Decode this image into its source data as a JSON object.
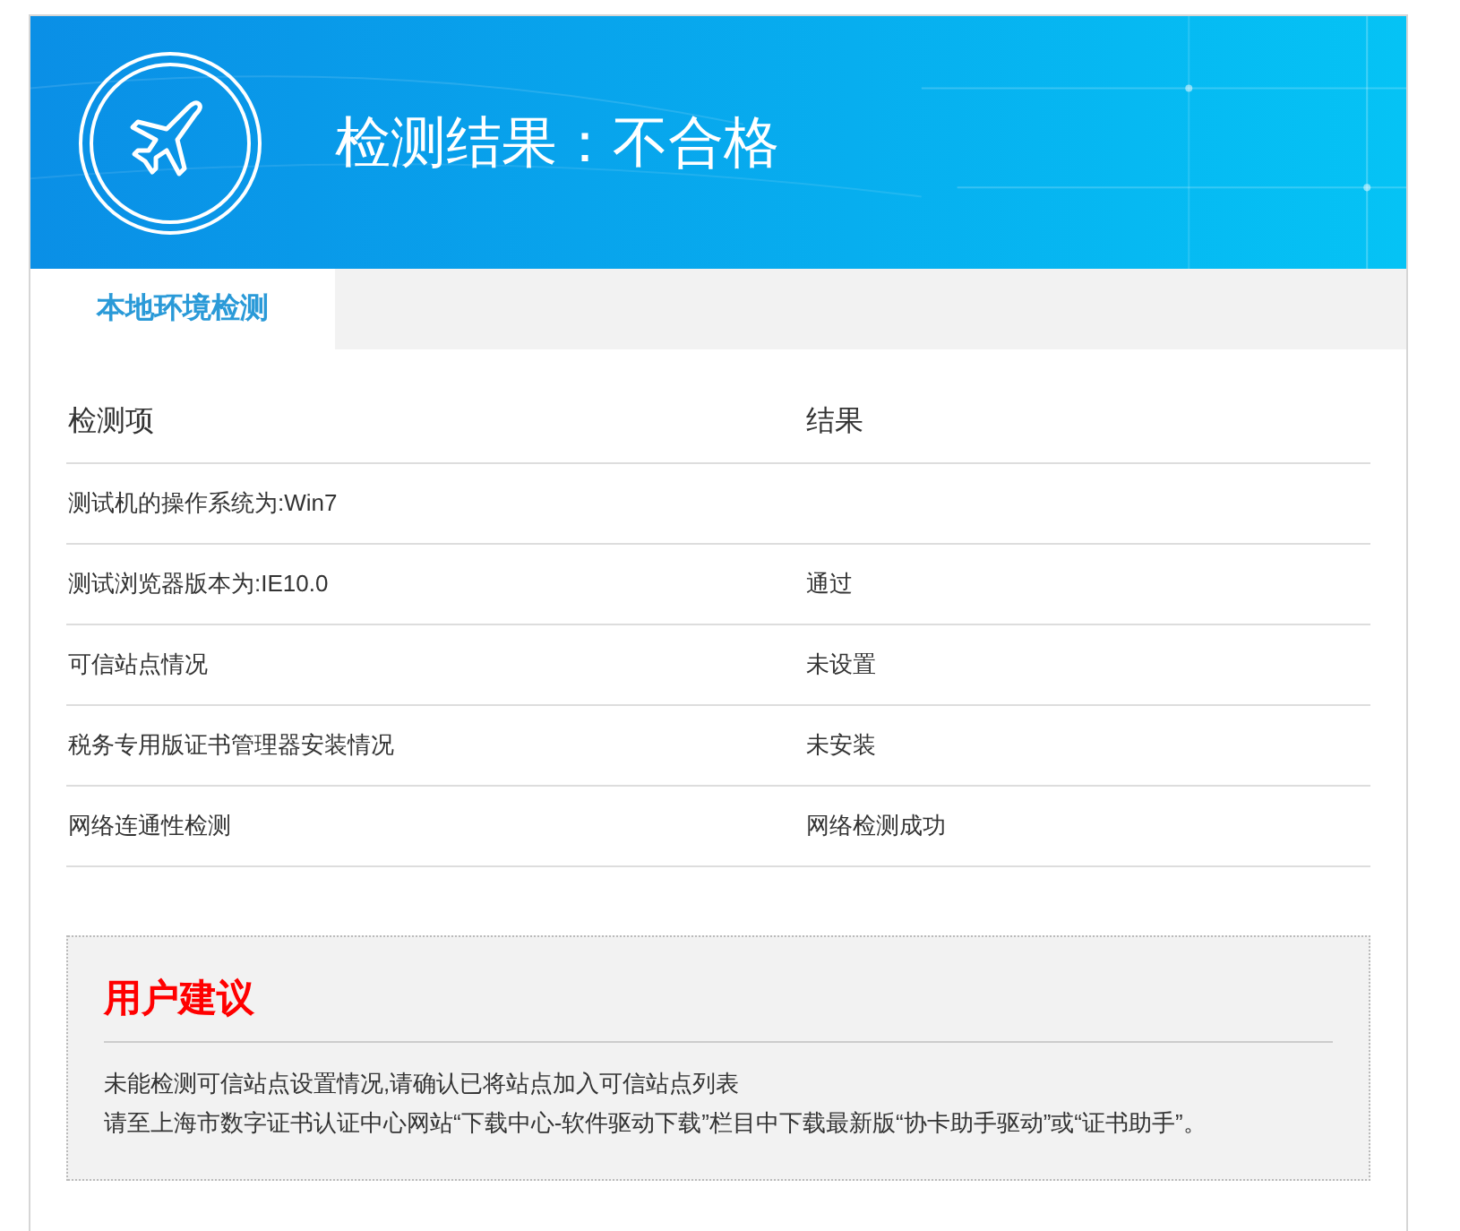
{
  "header": {
    "title": "检测结果：不合格"
  },
  "tabs": [
    {
      "label": "本地环境检测",
      "selected": true
    }
  ],
  "table": {
    "columns": [
      "检测项",
      "结果"
    ],
    "rows": [
      [
        "测试机的操作系统为:Win7",
        ""
      ],
      [
        "测试浏览器版本为:IE10.0",
        "通过"
      ],
      [
        "可信站点情况",
        "未设置"
      ],
      [
        "税务专用版证书管理器安装情况",
        "未安装"
      ],
      [
        "网络连通性检测",
        "网络检测成功"
      ]
    ]
  },
  "advice": {
    "title": "用户建议",
    "lines": [
      "未能检测可信站点设置情况,请确认已将站点加入可信站点列表",
      "请至上海市数字证书认证中心网站“下载中心-软件驱动下载”栏目中下载最新版“协卡助手驱动”或“证书助手”。"
    ]
  }
}
